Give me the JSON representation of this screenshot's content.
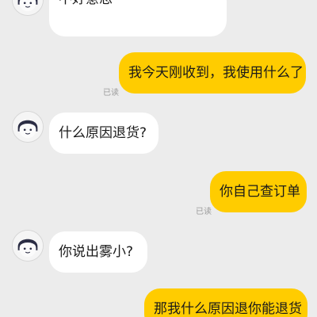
{
  "messages": [
    {
      "side": "in",
      "text_line1": "",
      "text_line2": "不好意思"
    },
    {
      "side": "out",
      "text": "我今天刚收到，我使用什么了",
      "status": "已读"
    },
    {
      "side": "in",
      "text": "什么原因退货?"
    },
    {
      "side": "out",
      "text": "你自己查订单",
      "status": "已读"
    },
    {
      "side": "in",
      "text": "你说出雾小?"
    },
    {
      "side": "out",
      "text": "那我什么原因退你能退货"
    }
  ],
  "colors": {
    "background": "#ececec",
    "incoming_bubble": "#ffffff",
    "outgoing_bubble": "#ffcc00",
    "read_status": "#9a9a9a"
  },
  "icons": {
    "avatar": "user-avatar-icon"
  }
}
